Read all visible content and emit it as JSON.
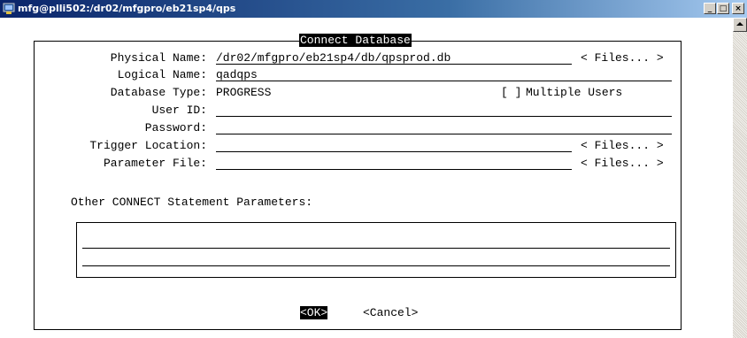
{
  "window": {
    "title": "mfg@plli502:/dr02/mfgpro/eb21sp4/qps",
    "minimize_glyph": "_",
    "maximize_glyph": "□",
    "close_glyph": "×"
  },
  "dialog": {
    "title": "Connect Database",
    "fields": {
      "physical_name": {
        "label": "Physical Name:",
        "value": "/dr02/mfgpro/eb21sp4/db/qpsprod.db",
        "files": "< Files... >"
      },
      "logical_name": {
        "label": "Logical Name:",
        "value": "qadqps"
      },
      "database_type": {
        "label": "Database Type:",
        "value": "PROGRESS"
      },
      "multiple_users": {
        "box": "[ ]",
        "label": "Multiple Users"
      },
      "user_id": {
        "label": "User ID:",
        "value": ""
      },
      "password": {
        "label": "Password:",
        "value": ""
      },
      "trigger_location": {
        "label": "Trigger Location:",
        "value": "",
        "files": "< Files... >"
      },
      "parameter_file": {
        "label": "Parameter File:",
        "value": "",
        "files": "< Files... >"
      }
    },
    "other_params_label": "Other CONNECT Statement Parameters:",
    "buttons": {
      "ok": "<OK>",
      "cancel": "<Cancel>"
    }
  }
}
